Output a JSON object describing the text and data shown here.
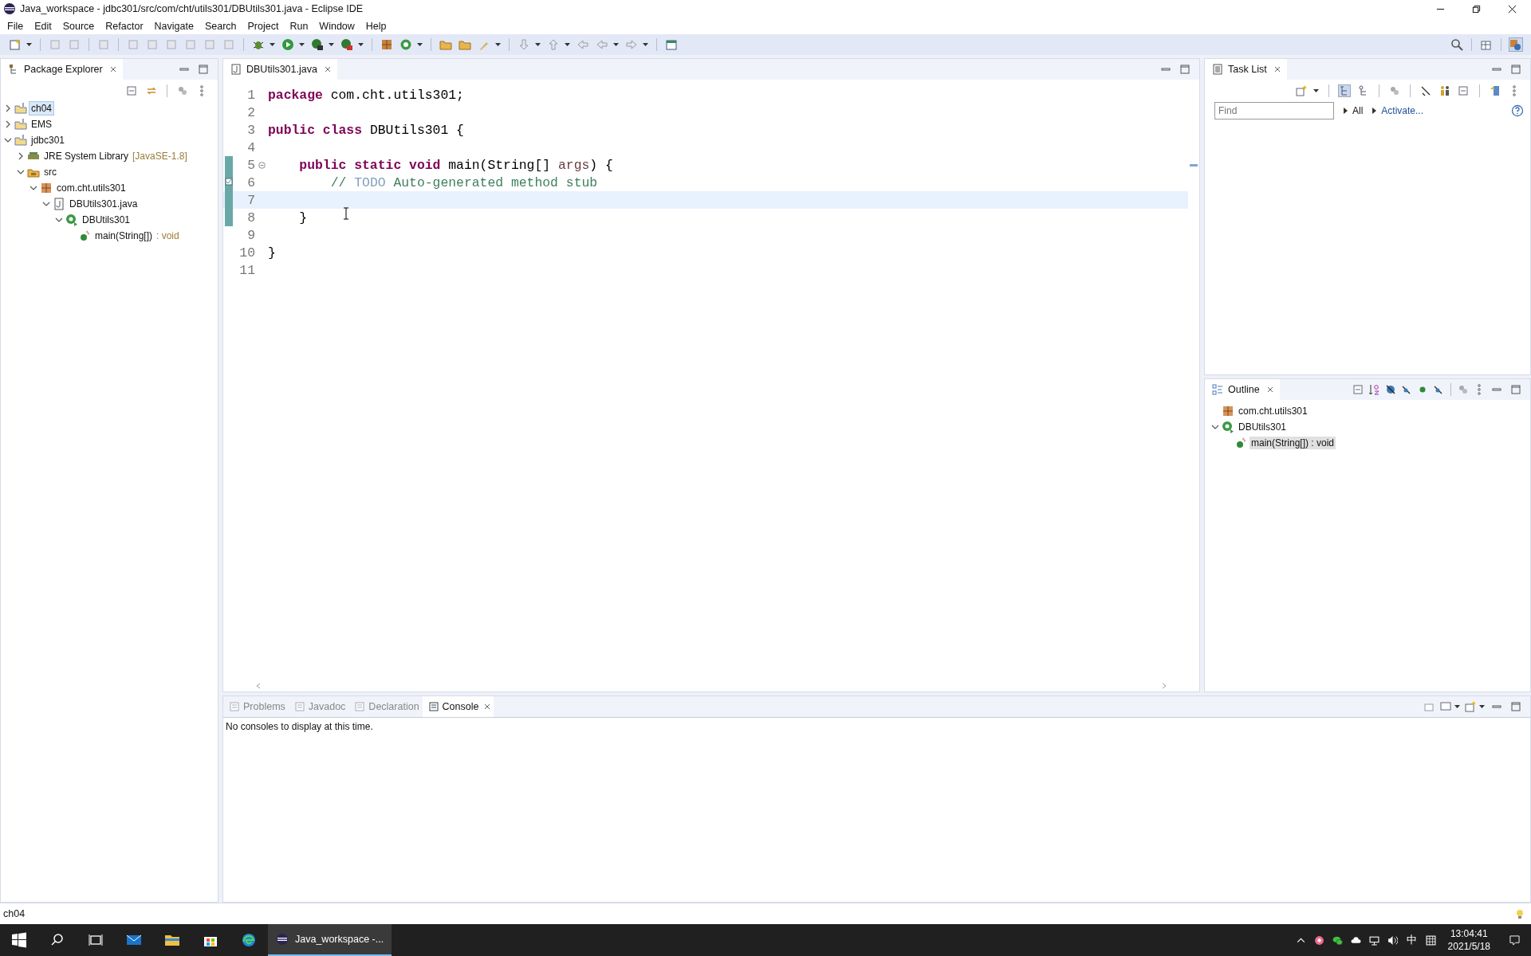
{
  "window": {
    "title": "Java_workspace - jdbc301/src/com/cht/utils301/DBUtils301.java - Eclipse IDE"
  },
  "menu": [
    "File",
    "Edit",
    "Source",
    "Refactor",
    "Navigate",
    "Search",
    "Project",
    "Run",
    "Window",
    "Help"
  ],
  "package_explorer": {
    "title": "Package Explorer",
    "tree": [
      {
        "label": "ch04",
        "kind": "project",
        "expanded": false,
        "selected": true
      },
      {
        "label": "EMS",
        "kind": "project",
        "expanded": false,
        "selected": false
      },
      {
        "label": "jdbc301",
        "kind": "project",
        "expanded": true,
        "selected": false,
        "children": [
          {
            "label": "JRE System Library",
            "decoration": "[JavaSE-1.8]",
            "kind": "library",
            "expanded": false,
            "selected": false
          },
          {
            "label": "src",
            "kind": "source-folder",
            "expanded": true,
            "selected": false,
            "children": [
              {
                "label": "com.cht.utils301",
                "kind": "package",
                "expanded": true,
                "selected": false,
                "children": [
                  {
                    "label": "DBUtils301.java",
                    "kind": "java-file",
                    "expanded": true,
                    "selected": false,
                    "children": [
                      {
                        "label": "DBUtils301",
                        "kind": "class",
                        "expanded": true,
                        "selected": false,
                        "children": [
                          {
                            "label": "main(String[])",
                            "decoration": ": void",
                            "kind": "method",
                            "selected": false
                          }
                        ]
                      }
                    ]
                  }
                ]
              }
            ]
          }
        ]
      }
    ]
  },
  "editor": {
    "tab": {
      "label": "DBUtils301.java"
    },
    "lines": [
      {
        "number": "1",
        "changed": false,
        "current": false,
        "tokens": [
          {
            "kind": "keyword",
            "text": "package"
          },
          {
            "kind": "plain",
            "text": " com.cht.utils301;"
          }
        ]
      },
      {
        "number": "2",
        "changed": false,
        "current": false
      },
      {
        "number": "3",
        "changed": false,
        "current": false,
        "tokens": [
          {
            "kind": "keyword",
            "text": "public class"
          },
          {
            "kind": "plain",
            "text": " DBUtils301 {"
          }
        ]
      },
      {
        "number": "4",
        "changed": false,
        "current": false
      },
      {
        "number": "5",
        "changed": true,
        "current": false,
        "fold": true,
        "tokens": [
          {
            "kind": "keyword",
            "text": "    public static void"
          },
          {
            "kind": "plain",
            "text": " main(String[] "
          },
          {
            "kind": "param",
            "text": "args"
          },
          {
            "kind": "plain",
            "text": ") {"
          }
        ]
      },
      {
        "number": "6",
        "changed": true,
        "current": false,
        "task": true,
        "tokens": [
          {
            "kind": "comment",
            "text": "        // "
          },
          {
            "kind": "todo",
            "text": "TODO"
          },
          {
            "kind": "comment",
            "text": " Auto-generated method stub"
          }
        ]
      },
      {
        "number": "7",
        "changed": true,
        "current": true
      },
      {
        "number": "8",
        "changed": true,
        "current": false,
        "tokens": [
          {
            "kind": "plain",
            "text": "    }"
          }
        ]
      },
      {
        "number": "9",
        "changed": false,
        "current": false
      },
      {
        "number": "10",
        "changed": false,
        "current": false,
        "tokens": [
          {
            "kind": "plain",
            "text": "}"
          }
        ]
      },
      {
        "number": "11",
        "changed": false,
        "current": false
      }
    ]
  },
  "task_list": {
    "title": "Task List",
    "find": {
      "placeholder": "Find"
    },
    "links": [
      "All",
      "Activate..."
    ]
  },
  "outline": {
    "title": "Outline",
    "tree": [
      {
        "label": "com.cht.utils301",
        "kind": "package",
        "selected": false
      },
      {
        "label": "DBUtils301",
        "kind": "class",
        "expanded": true,
        "selected": false,
        "children": [
          {
            "label": "main(String[]) : void",
            "kind": "method",
            "selected": true
          }
        ]
      }
    ]
  },
  "bottom_panel": {
    "tabs": [
      {
        "label": "Problems",
        "selected": false
      },
      {
        "label": "Javadoc",
        "selected": false
      },
      {
        "label": "Declaration",
        "selected": false
      },
      {
        "label": "Console",
        "selected": true
      }
    ],
    "message": "No consoles to display at this time."
  },
  "status_bar": {
    "text": "ch04"
  },
  "taskbar": {
    "apps": [
      {
        "label": "Java_workspace -...",
        "active": true
      }
    ],
    "ime": "中",
    "time": "13:04:41",
    "date": "2021/5/18"
  }
}
